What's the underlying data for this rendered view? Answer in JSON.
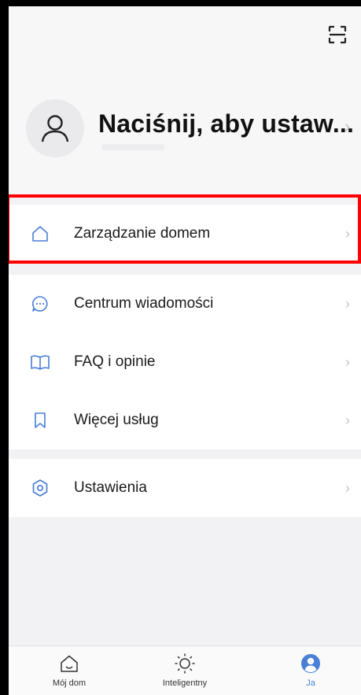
{
  "header": {
    "scan_icon": "scan-icon",
    "profile_name": "Naciśnij, aby ustaw...",
    "profile_chevron": "›"
  },
  "menu_group_1": [
    {
      "label": "Zarządzanie domem",
      "icon": "home-icon",
      "chevron": "›"
    }
  ],
  "menu_group_2": [
    {
      "label": "Centrum wiadomości",
      "icon": "message-icon",
      "chevron": "›"
    },
    {
      "label": "FAQ i opinie",
      "icon": "book-icon",
      "chevron": "›"
    },
    {
      "label": "Więcej usług",
      "icon": "bookmark-icon",
      "chevron": "›"
    }
  ],
  "menu_group_3": [
    {
      "label": "Ustawienia",
      "icon": "settings-icon",
      "chevron": "›"
    }
  ],
  "tabbar": {
    "tabs": [
      {
        "label": "Mój dom",
        "icon": "home-outline-icon",
        "active": false
      },
      {
        "label": "Inteligentny",
        "icon": "sun-icon",
        "active": false
      },
      {
        "label": "Ja",
        "icon": "person-icon",
        "active": true
      }
    ]
  },
  "colors": {
    "accent": "#4a7fd6",
    "highlight": "#ff0000",
    "background": "#f2f2f4"
  }
}
